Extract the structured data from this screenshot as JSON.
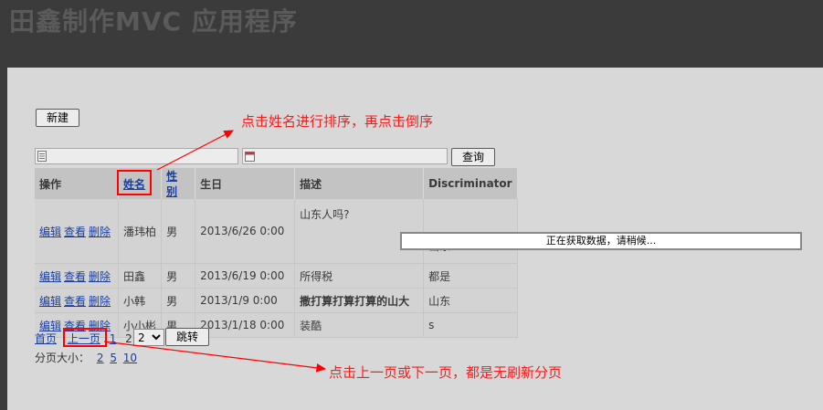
{
  "app": {
    "title": "田鑫制作MVC 应用程序"
  },
  "toolbar": {
    "new_label": "新建",
    "search_label": "查询"
  },
  "search": {
    "text_value": "",
    "date_value": ""
  },
  "grid": {
    "headers": {
      "ops": "操作",
      "name": "姓名",
      "gender": "性别",
      "birthday": "生日",
      "desc": "描述",
      "disc": "Discriminator"
    },
    "row_actions": {
      "edit": "编辑",
      "view": "查看",
      "delete": "删除"
    },
    "rows": [
      {
        "name": "潘玮柏",
        "gender": "男",
        "birthday": "2013/6/26 0:00",
        "desc": "山东人吗?",
        "disc": "山东"
      },
      {
        "name": "田鑫",
        "gender": "男",
        "birthday": "2013/6/19 0:00",
        "desc": "所得税",
        "disc": "都是"
      },
      {
        "name": "小韩",
        "gender": "男",
        "birthday": "2013/1/9 0:00",
        "desc": "撒打算打算打算的山大",
        "disc": "山东"
      },
      {
        "name": "小小彬",
        "gender": "男",
        "birthday": "2013/1/18 0:00",
        "desc": "装酷",
        "disc": "s"
      }
    ]
  },
  "pager": {
    "first": "首页",
    "prev": "上一页",
    "page1": "1",
    "page2": "2",
    "select_value": "2",
    "jump": "跳转",
    "size_label": "分页大小：",
    "size1": "2",
    "size2": "5",
    "size3": "10"
  },
  "loading": {
    "text": "正在获取数据，请稍候..."
  },
  "annotations": {
    "sort_hint": "点击姓名进行排序，再点击倒序",
    "page_hint": "点击上一页或下一页，都是无刷新分页"
  },
  "colors": {
    "annotation": "#ff0000",
    "link": "#1a3fa0"
  }
}
